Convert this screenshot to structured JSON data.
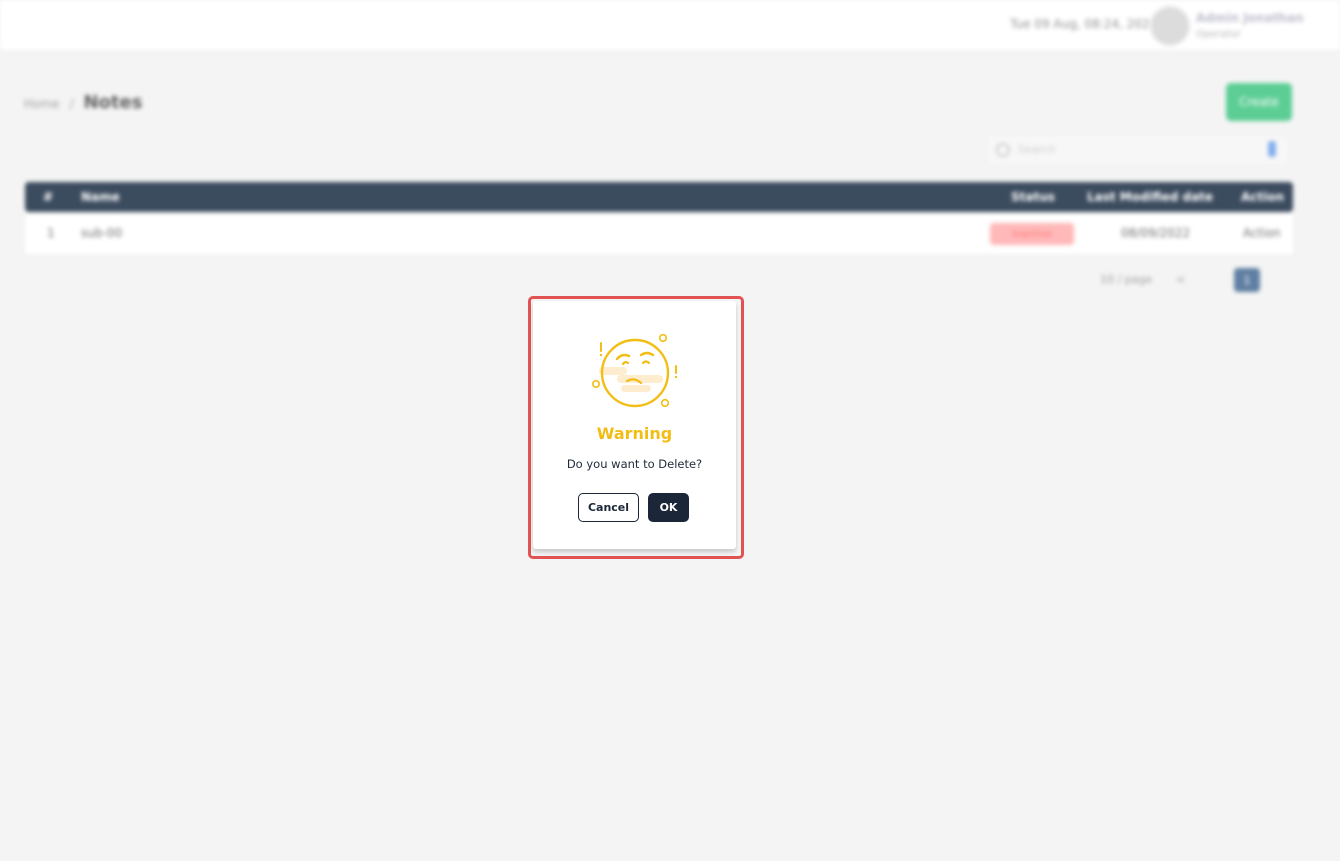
{
  "topbar": {
    "info_text": "Tue 09 Aug, 08:24, 2022",
    "user_name": "Admin Jonathan",
    "user_role": "Operator"
  },
  "breadcrumb": {
    "parent": "Home",
    "separator": "/",
    "current": "Notes"
  },
  "toolbar": {
    "create_label": "Create",
    "search_placeholder": "Search"
  },
  "table": {
    "columns": [
      "#",
      "Name",
      "Status",
      "Last Modified date",
      "Action"
    ],
    "rows": [
      {
        "index": "1",
        "name": "sub-00",
        "status": "Inactive",
        "modified": "08/09/2022",
        "action": "Action"
      }
    ]
  },
  "pagination": {
    "per_page": "10 / page",
    "prev": "<",
    "current_page": "1"
  },
  "dialog": {
    "icon": "warning-face-icon",
    "title": "Warning",
    "message": "Do you want to Delete?",
    "cancel_label": "Cancel",
    "ok_label": "OK"
  },
  "colors": {
    "highlight": "#e15252",
    "warning": "#f2bd14",
    "primary": "#1b2738",
    "create": "#4fca8c"
  }
}
